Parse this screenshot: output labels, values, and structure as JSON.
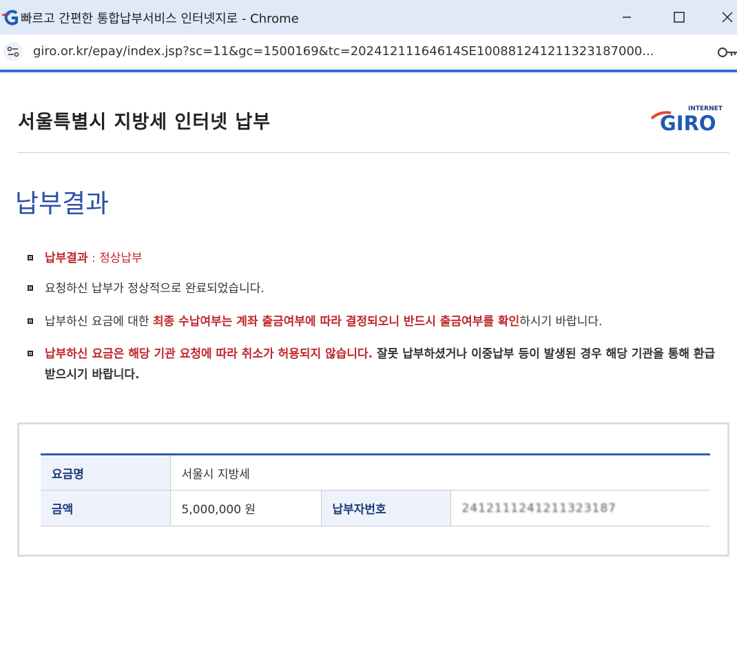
{
  "window": {
    "title": "빠르고 간편한 통합납부서비스 인터넷지로 - Chrome",
    "url": "giro.or.kr/epay/index.jsp?sc=11&gc=1500169&tc=20241211164614SE100881241211323187000..."
  },
  "page": {
    "title": "서울특별시 지방세 인터넷 납부",
    "logo_small": "INTERNET",
    "logo_big": "GIRO",
    "result_heading": "납부결과"
  },
  "notices": {
    "n1_label": "납부결과",
    "n1_sep": " : ",
    "n1_value": "정상납부",
    "n2": "요청하신 납부가 정상적으로 완료되었습니다.",
    "n3_pre": "납부하신 요금에 대한 ",
    "n3_red": "최종 수납여부는 계좌 출금여부에 따라 결정되오니 반드시 출금여부를 확인",
    "n3_post": "하시기 바랍니다.",
    "n4_red": "납부하신 요금은 해당 기관 요청에 따라 취소가 허용되지 않습니다.",
    "n4_post": " 잘못 납부하셨거나 이중납부 등이 발생된 경우 해당 기관을 통해 환급받으시기 바랍니다."
  },
  "result_table": {
    "fee_name_label": "요금명",
    "fee_name_value": "서울시 지방세",
    "amount_label": "금액",
    "amount_value": "5,000,000 원",
    "payer_no_label": "납부자번호",
    "payer_no_value": "241211124121132318​7"
  },
  "colors": {
    "accent_blue": "#2f5bb7",
    "heading_blue": "#2b4ea8",
    "alert_red": "#c0272d"
  }
}
